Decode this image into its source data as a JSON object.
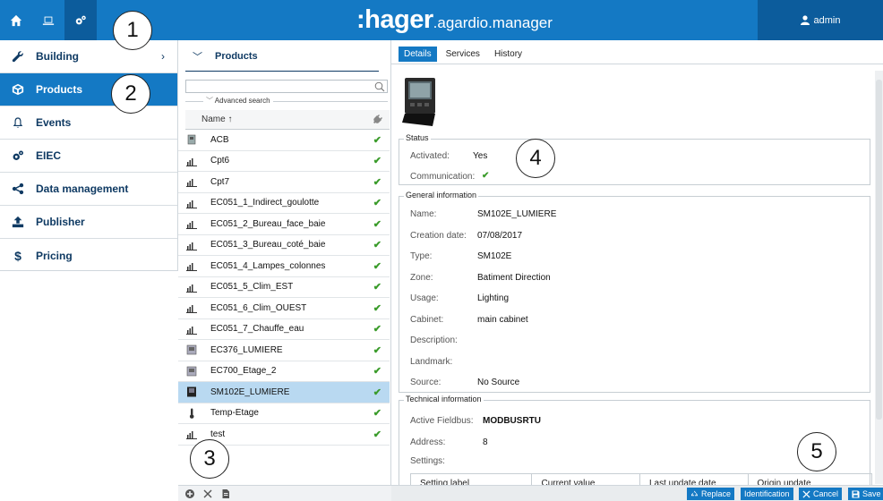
{
  "header": {
    "brand_main": ":hager",
    "brand_sub": ".agardio.manager",
    "user": "admin",
    "icons": [
      "home-icon",
      "laptop-icon",
      "gears-icon"
    ]
  },
  "callouts": [
    "1",
    "2",
    "3",
    "4",
    "5"
  ],
  "nav": {
    "items": [
      {
        "label": "Building",
        "icon": "wrench-icon",
        "chevron": "›"
      },
      {
        "label": "Products",
        "icon": "box-icon"
      },
      {
        "label": "Events",
        "icon": "bell-icon"
      },
      {
        "label": "EIEC",
        "icon": "gears-icon"
      },
      {
        "label": "Data management",
        "icon": "share-icon"
      },
      {
        "label": "Publisher",
        "icon": "upload-icon"
      },
      {
        "label": "Pricing",
        "icon": "dollar-icon"
      }
    ]
  },
  "products_panel": {
    "chevron": "﹀",
    "title": "Products",
    "search_placeholder": "",
    "advanced_search": "Advanced search",
    "column_name": "Name ↑",
    "rows": [
      {
        "name": "ACB",
        "icon": "breaker-icon",
        "status": "✔"
      },
      {
        "name": "Cpt6",
        "icon": "meter-icon",
        "status": "✔"
      },
      {
        "name": "Cpt7",
        "icon": "meter-icon",
        "status": "✔"
      },
      {
        "name": "EC051_1_Indirect_goulotte",
        "icon": "meter-icon",
        "status": "✔"
      },
      {
        "name": "EC051_2_Bureau_face_baie",
        "icon": "meter-icon",
        "status": "✔"
      },
      {
        "name": "EC051_3_Bureau_coté_baie",
        "icon": "meter-icon",
        "status": "✔"
      },
      {
        "name": "EC051_4_Lampes_colonnes",
        "icon": "meter-icon",
        "status": "✔"
      },
      {
        "name": "EC051_5_Clim_EST",
        "icon": "meter-icon",
        "status": "✔"
      },
      {
        "name": "EC051_6_Clim_OUEST",
        "icon": "meter-icon",
        "status": "✔"
      },
      {
        "name": "EC051_7_Chauffe_eau",
        "icon": "meter-icon",
        "status": "✔"
      },
      {
        "name": "EC376_LUMIERE",
        "icon": "device-icon",
        "status": "✔"
      },
      {
        "name": "EC700_Etage_2",
        "icon": "device-icon",
        "status": "✔"
      },
      {
        "name": "SM102E_LUMIERE",
        "icon": "power-meter-icon",
        "status": "✔",
        "selected": true
      },
      {
        "name": "Temp-Etage",
        "icon": "thermometer-icon",
        "status": "✔"
      },
      {
        "name": "test",
        "icon": "meter-icon",
        "status": "✔"
      }
    ],
    "footer_icons": [
      "add-icon",
      "delete-icon",
      "document-icon"
    ]
  },
  "detail": {
    "tabs": [
      "Details",
      "Services",
      "History"
    ],
    "status": {
      "title": "Status",
      "activated_label": "Activated:",
      "activated_value": "Yes",
      "communication_label": "Communication:",
      "communication_value": "✔"
    },
    "general": {
      "title": "General information",
      "fields": [
        {
          "label": "Name:",
          "value": "SM102E_LUMIERE"
        },
        {
          "label": "Creation date:",
          "value": "07/08/2017"
        },
        {
          "label": "Type:",
          "value": "SM102E"
        },
        {
          "label": "Zone:",
          "value": "Batiment Direction"
        },
        {
          "label": "Usage:",
          "value": "Lighting"
        },
        {
          "label": "Cabinet:",
          "value": "main cabinet"
        },
        {
          "label": "Description:",
          "value": ""
        },
        {
          "label": "Landmark:",
          "value": ""
        },
        {
          "label": "Source:",
          "value": "No Source"
        }
      ]
    },
    "technical": {
      "title": "Technical information",
      "fieldbus_label": "Active Fieldbus:",
      "fieldbus_value": "MODBUSRTU",
      "address_label": "Address:",
      "address_value": "8",
      "settings_label": "Settings:",
      "columns": [
        "Setting label",
        "Current value",
        "Last update date",
        "Origin update"
      ]
    },
    "footer_buttons": [
      {
        "label": "Replace",
        "icon": "recycle-icon"
      },
      {
        "label": "Identification",
        "icon": ""
      },
      {
        "label": "Cancel",
        "icon": "close-icon"
      },
      {
        "label": "Save",
        "icon": "save-icon"
      }
    ]
  }
}
